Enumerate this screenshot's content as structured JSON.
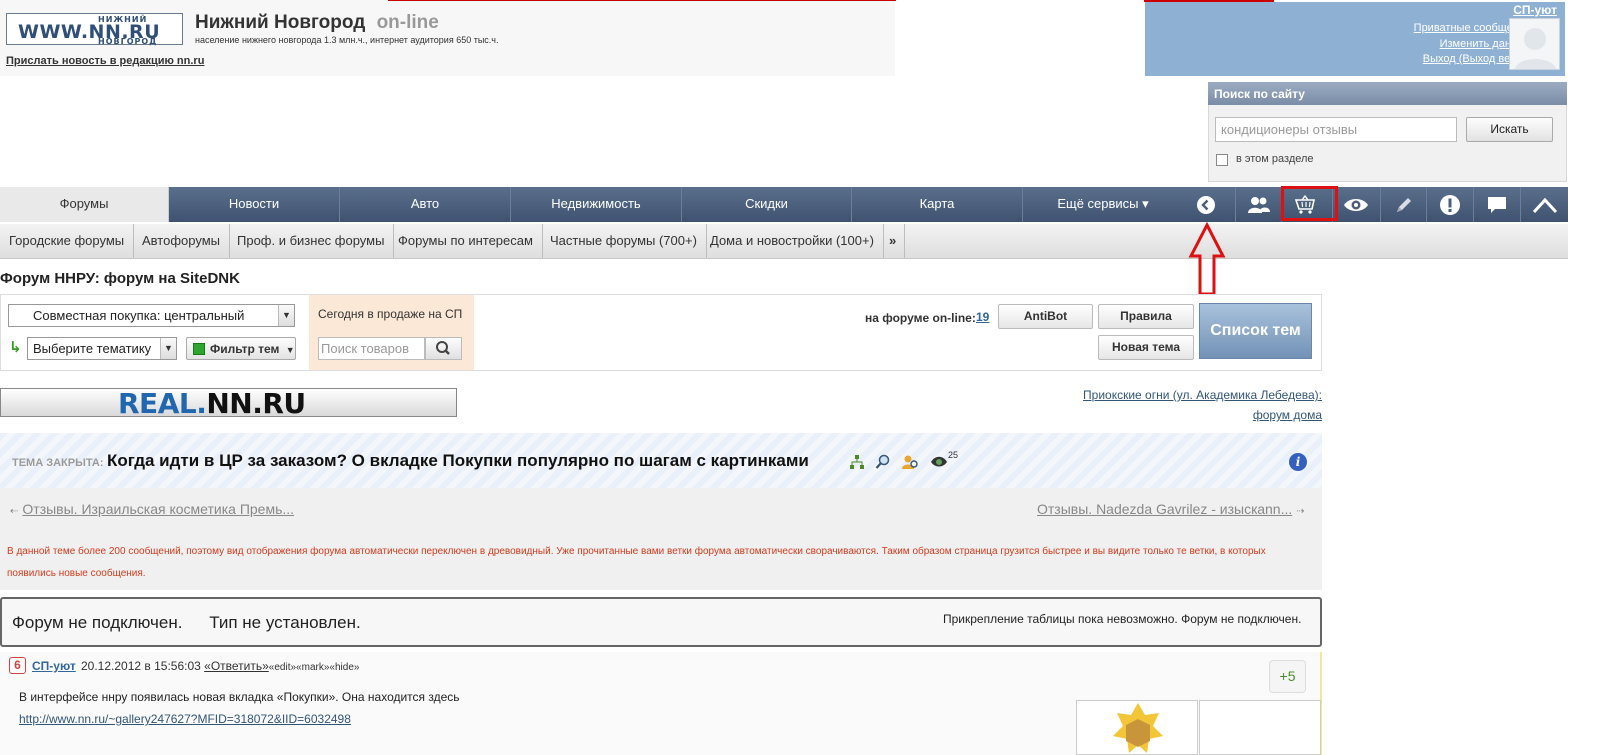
{
  "header": {
    "logo_main": "WWW.NN.RU",
    "logo_top": "НИЖНИЙ",
    "logo_bottom": "НОВГОРОД",
    "title": "Нижний Новгород",
    "title_suffix": "on-line",
    "subtitle": "население нижнего новгорода 1.3 млн.ч., интернет аудитория 650 тыс.ч.",
    "send_news": "Прислать новость в редакцию nn.ru"
  },
  "user": {
    "name": "СП-уют",
    "links": [
      "Приватные сообщения",
      "Изменить данные",
      "Выход (Выход везде)"
    ]
  },
  "search": {
    "title": "Поиск по сайту",
    "placeholder": "кондиционеры отзывы",
    "button": "Искать",
    "checkbox_label": "в этом разделе"
  },
  "nav": {
    "items": [
      "Форумы",
      "Новости",
      "Авто",
      "Недвижимость",
      "Скидки",
      "Карта",
      "Ещё сервисы"
    ],
    "more_caret": "▾",
    "icons": [
      "back-circle-icon",
      "users-icon",
      "shopping-basket-icon",
      "eye-icon",
      "pencil-icon",
      "exclamation-icon",
      "chat-bubble-icon",
      "up-arrow-icon"
    ]
  },
  "subnav": {
    "items": [
      "Городские форумы",
      "Автофорумы",
      "Проф. и бизнес форумы",
      "Форумы по интересам",
      "Частные форумы (700+)",
      "Дома и новостройки (100+)"
    ],
    "more": "»"
  },
  "forum": {
    "title": "Форум ННРУ: форум на SiteDNK",
    "select_forum": "Совместная покупка: центральный",
    "select_topic": "Выберите тематику",
    "filter": "Фильтр тем",
    "sale_label": "Сегодня в продаже на СП",
    "goods_placeholder": "Поиск товаров",
    "online_label": "на форуме on-line:",
    "online_count": "19",
    "antibot": "AntiBot",
    "rules": "Правила",
    "new_topic": "Новая тема",
    "topics_list": "Список тем"
  },
  "banner": {
    "real_a": "REAL.",
    "real_b": "NN.RU",
    "house_link_1": "Приокские огни (ул. Академика Лебедева):",
    "house_link_2": "форум дома"
  },
  "topic": {
    "closed_label": "ТЕМА ЗАКРЫТА:",
    "title": "Когда идти в ЦР за заказом? О вкладке Покупки популярно по шагам с картинками",
    "views": "25",
    "prev": "Отзывы. Израильская косметика Премь...",
    "next": "Отзывы. Nadezda Gavrilez - изыскann...",
    "tree_note": "В данной теме более 200 сообщений, поэтому вид отображения форума автоматически переключен в древовидный. Уже прочитанные вами ветки форума автоматически сворачиваются. Таким образом страница грузится быстрее и вы видите только те ветки, в которых появились новые сообщения."
  },
  "notice": {
    "left_1": "Форум не подключен.",
    "left_2": "Тип не установлен.",
    "right": "Прикрепление таблицы пока невозможно. Форум не подключен."
  },
  "post": {
    "badge": "6",
    "author": "СП-уют",
    "date": "20.12.2012 в 15:56:03",
    "reply": "«Ответить»",
    "edit": "«edit»",
    "mark": "«mark»",
    "hide": "«hide»",
    "text": "В интерфейсе ннру появилась новая вкладка «Покупки». Она находится здесь",
    "link": "http://www.nn.ru/~gallery247627?MFID=318072&IID=6032498",
    "rating": "+5"
  },
  "colors": {
    "nav_bg": "#4a5e7c",
    "user_panel": "#8eb1d3",
    "highlight": "#d11111",
    "sale_panel": "#fbe8d6"
  }
}
